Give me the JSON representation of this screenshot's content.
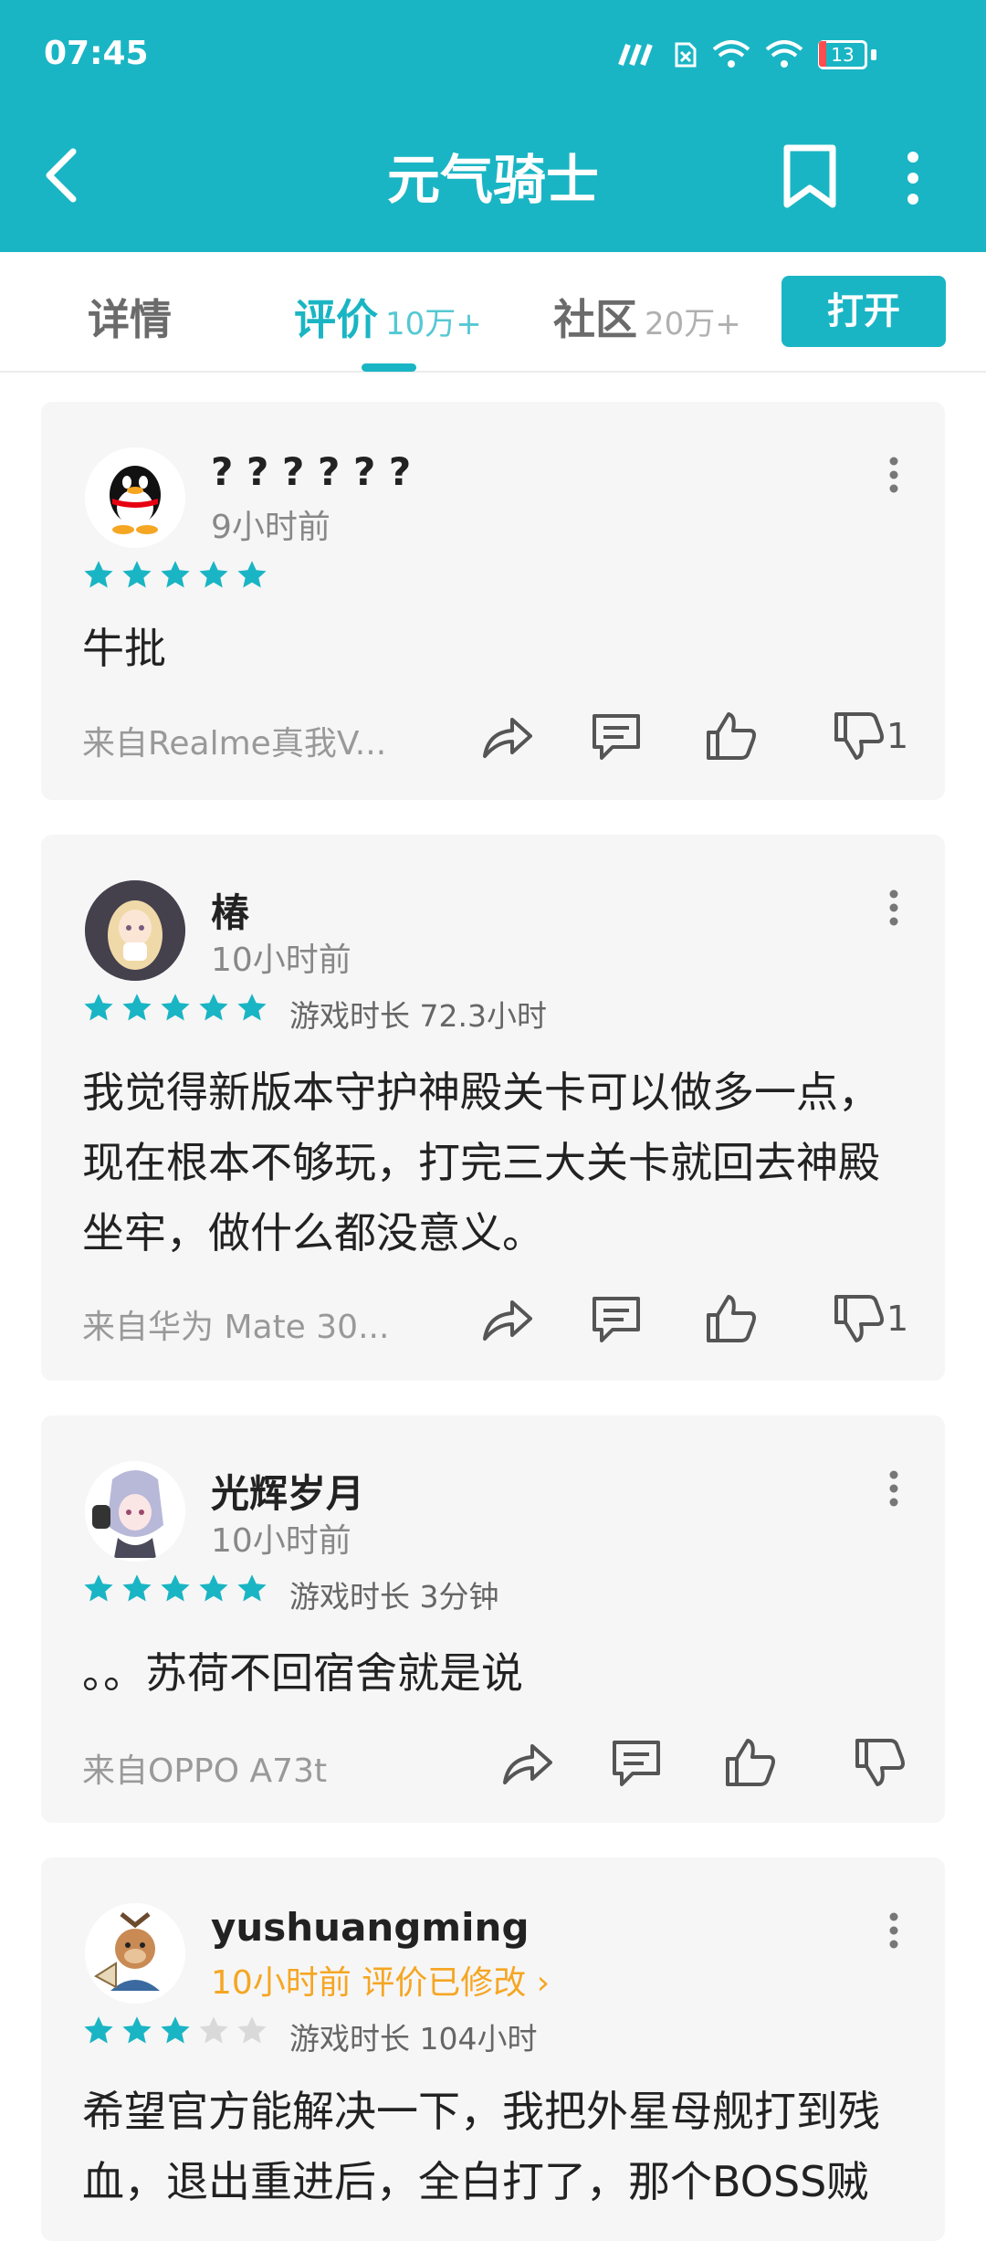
{
  "status_bar": {
    "time": "07:45",
    "battery": "13"
  },
  "header": {
    "title": "元气骑士"
  },
  "tabs": [
    {
      "label": "详情",
      "count": ""
    },
    {
      "label": "评价",
      "count": "10万+"
    },
    {
      "label": "社区",
      "count": "20万+"
    }
  ],
  "open_button": "打开",
  "reviews": [
    {
      "username": "? ? ? ? ? ?",
      "time": "9小时前",
      "rating": 5,
      "playtime": "",
      "content": "牛批",
      "device": "来自Realme真我V...",
      "dislikes": "1"
    },
    {
      "username": "椿",
      "time": "10小时前",
      "rating": 5,
      "playtime": "游戏时长 72.3小时",
      "content": "我觉得新版本守护神殿关卡可以做多一点，现在根本不够玩，打完三大关卡就回去神殿坐牢，做什么都没意义。",
      "device": "来自华为 Mate 30...",
      "dislikes": "1"
    },
    {
      "username": "光辉岁月",
      "time": "10小时前",
      "rating": 5,
      "playtime": "游戏时长 3分钟",
      "content": "。。苏荷不回宿舍就是说",
      "device": "来自OPPO A73t",
      "dislikes": ""
    },
    {
      "username": "yushuangming",
      "time": "10小时前 评价已修改 ›",
      "rating": 3,
      "playtime": "游戏时长 104小时",
      "content": "希望官方能解决一下，我把外星母舰打到残血，退出重进后，全白打了，那个BOSS贼",
      "device": "",
      "dislikes": ""
    }
  ],
  "colors": {
    "accent": "#1ab5c4",
    "card_bg": "#f6f6f6",
    "star_empty": "#d9d9d9",
    "edited": "#f5a623"
  }
}
